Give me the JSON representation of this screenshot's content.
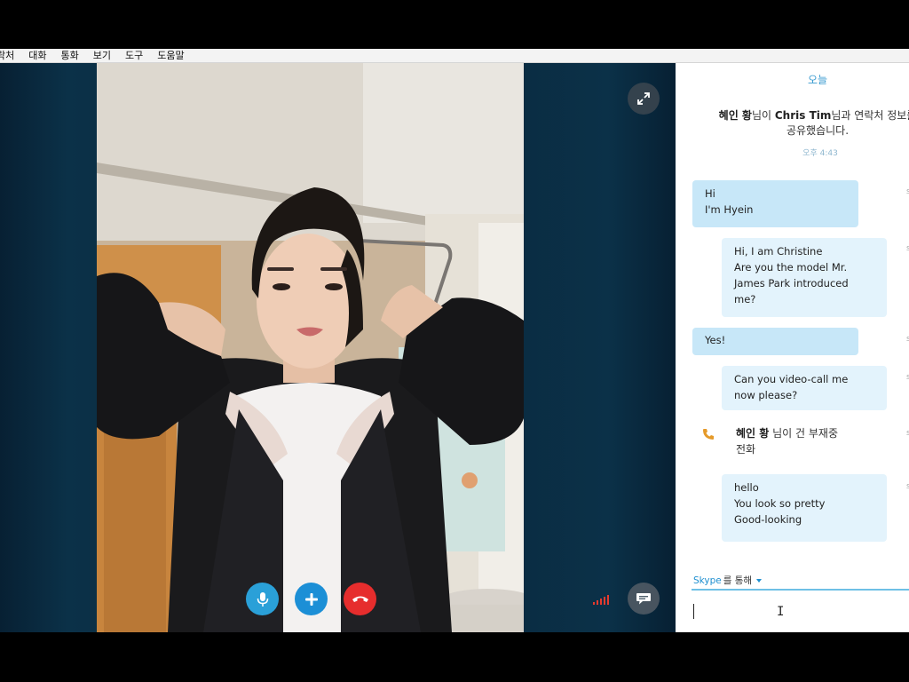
{
  "menu": {
    "items": [
      "락처",
      "대화",
      "통화",
      "보기",
      "도구",
      "도움말"
    ]
  },
  "call": {
    "icons": {
      "expand": "expand-arrows-icon",
      "mic": "microphone-icon",
      "add": "plus-icon",
      "hangup": "phone-hangup-icon",
      "signal": "signal-bars-icon",
      "chat": "chat-bubble-icon"
    },
    "colors": {
      "mic": "#2aa0d8",
      "add": "#1c8fd6",
      "hangup": "#e62d2d",
      "signal": "#e63b2e"
    }
  },
  "chat": {
    "day_label": "오늘",
    "system_message": {
      "user": "혜인 황",
      "suffix1": "님이 ",
      "contact": "Chris Tim",
      "suffix2": "님과 연락처 정보를",
      "line2": "공유했습니다.",
      "time": "오후 4:43"
    },
    "messages": [
      {
        "direction": "in",
        "lines": [
          "Hi",
          "I'm Hyein"
        ]
      },
      {
        "direction": "out",
        "lines": [
          "Hi, I am Christine",
          "Are you the model Mr.",
          "James Park introduced",
          "me?"
        ]
      },
      {
        "direction": "in",
        "lines": [
          "Yes!"
        ]
      },
      {
        "direction": "out",
        "lines": [
          "Can you video-call me",
          "now please?"
        ]
      },
      {
        "direction": "out",
        "lines": [
          "hello",
          "You look so pretty",
          "Good-looking"
        ]
      }
    ],
    "missed_call": {
      "user": "혜인 황",
      "text1": " 님이 건 부재중",
      "text2": "전화",
      "icon": "phone-icon"
    },
    "compose": {
      "via_service": "Skype",
      "via_suffix": "를 통해",
      "input_value": ""
    }
  }
}
